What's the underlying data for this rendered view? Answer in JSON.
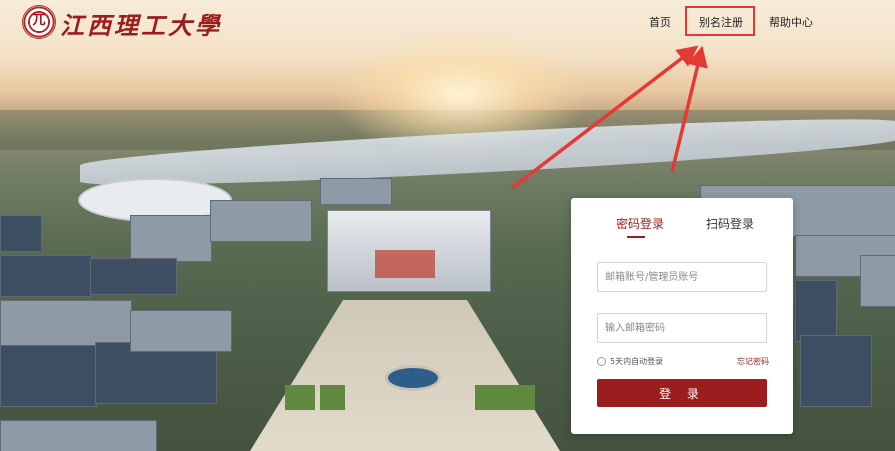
{
  "header": {
    "logo_text": "江西理工大學",
    "logo_emblem_glyph": "兀",
    "nav": {
      "home": "首页",
      "alias_register": "别名注册",
      "help_center": "帮助中心"
    }
  },
  "login": {
    "tabs": {
      "password_login": "密码登录",
      "qr_login": "扫码登录"
    },
    "active_tab": "password_login",
    "account_placeholder": "邮箱账号/管理员账号",
    "account_value": "",
    "password_placeholder": "输入邮箱密码",
    "password_value": "",
    "remember_label": "5天内自动登录",
    "forgot_label": "忘记密码",
    "submit_label": "登 录"
  },
  "colors": {
    "brand": "#9b1d1d",
    "annotation": "#e53935"
  },
  "icons": {
    "logo": "university-emblem-icon",
    "remember": "radio-circle-icon"
  }
}
